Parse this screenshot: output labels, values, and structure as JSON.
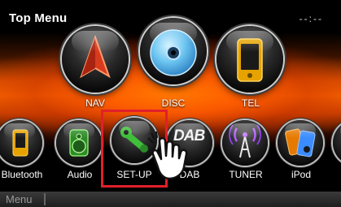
{
  "header": {
    "title": "Top Menu",
    "clock": "--:--"
  },
  "top_row": [
    {
      "key": "nav",
      "label": "NAV"
    },
    {
      "key": "disc",
      "label": "DISC"
    },
    {
      "key": "tel",
      "label": "TEL"
    }
  ],
  "bottom_row": [
    {
      "key": "bluetooth",
      "label": "Bluetooth"
    },
    {
      "key": "audio",
      "label": "Audio"
    },
    {
      "key": "setup",
      "label": "SET-UP"
    },
    {
      "key": "dab",
      "label": "DAB",
      "icon_text": "DAB"
    },
    {
      "key": "tuner",
      "label": "TUNER"
    },
    {
      "key": "ipod",
      "label": "iPod"
    }
  ],
  "menu_bar": {
    "label": "Menu"
  },
  "colors": {
    "accent_orange": "#ff6a00",
    "highlight_red": "#e0202a"
  }
}
